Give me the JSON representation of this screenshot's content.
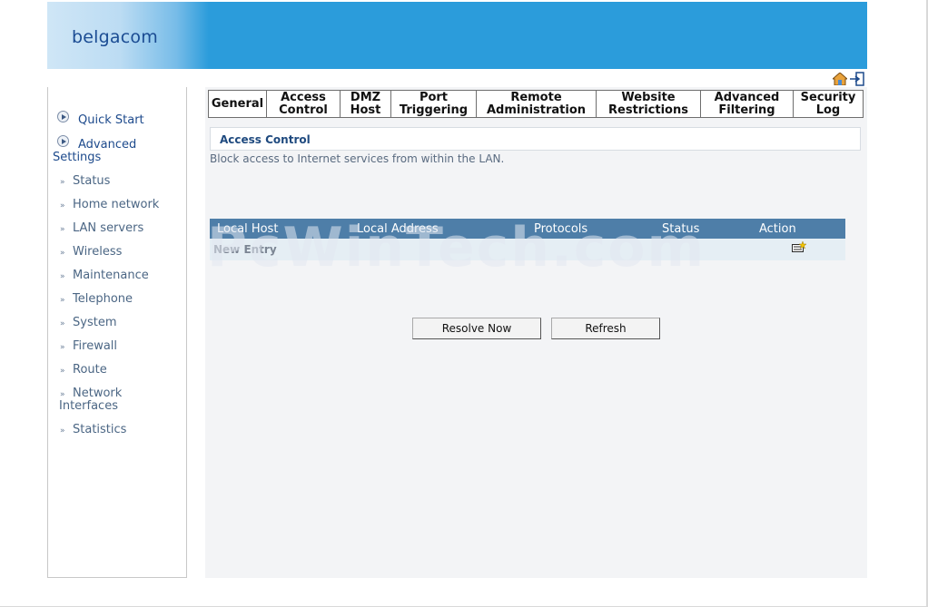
{
  "header": {
    "brand": "belgacom",
    "brand_color": "#1b4c93",
    "banner_color": "#2b9cdb",
    "icons": [
      "home-icon",
      "logout-icon"
    ]
  },
  "sidebar": {
    "main_items": [
      {
        "label": "Quick Start",
        "icon": "circle-arrow-icon"
      },
      {
        "label": "Advanced",
        "label2": "Settings",
        "icon": "circle-arrow-icon"
      }
    ],
    "sub_items": [
      {
        "label": "Status"
      },
      {
        "label": "Home network"
      },
      {
        "label": "LAN servers"
      },
      {
        "label": "Wireless"
      },
      {
        "label": "Maintenance"
      },
      {
        "label": "Telephone"
      },
      {
        "label": "System"
      },
      {
        "label": "Firewall"
      },
      {
        "label": "Route"
      },
      {
        "label": "Network",
        "label2": "Interfaces"
      },
      {
        "label": "Statistics"
      }
    ],
    "bullet": "»"
  },
  "tabs": [
    {
      "line1": "General",
      "line2": "",
      "active": true
    },
    {
      "line1": "Access",
      "line2": "Control"
    },
    {
      "line1": "DMZ",
      "line2": "Host"
    },
    {
      "line1": "Port",
      "line2": "Triggering"
    },
    {
      "line1": "Remote",
      "line2": "Administration"
    },
    {
      "line1": "Website",
      "line2": "Restrictions"
    },
    {
      "line1": "Advanced",
      "line2": "Filtering"
    },
    {
      "line1": "Security",
      "line2": "Log"
    }
  ],
  "section": {
    "title": "Access Control",
    "description": "Block access to Internet services from within the LAN."
  },
  "table": {
    "columns": [
      "Local Host",
      "Local Address",
      "Protocols",
      "Status",
      "Action"
    ],
    "new_entry_label": "New Entry",
    "header_color": "#4e7ea8",
    "row_color": "#e5eef4"
  },
  "watermark": "PcWinTech.com",
  "buttons": {
    "resolve_now": "Resolve Now",
    "refresh": "Refresh"
  }
}
